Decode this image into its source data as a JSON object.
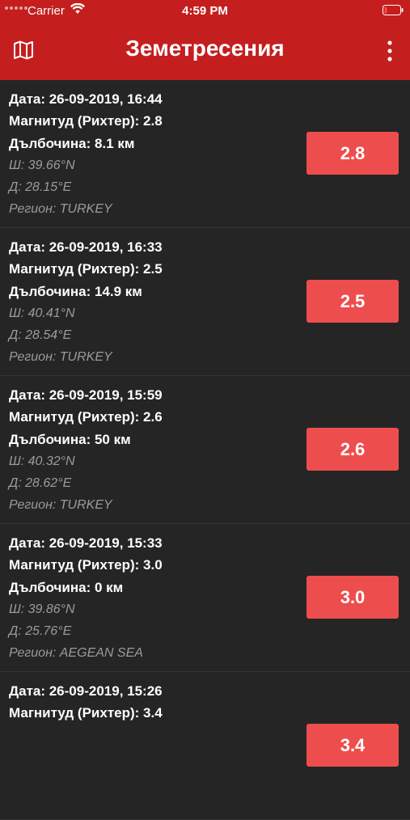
{
  "status_bar": {
    "carrier": "Carrier",
    "time": "4:59 PM"
  },
  "header": {
    "title": "Земетресения",
    "left_icon": "map-icon",
    "right_icon": "more-vertical-icon"
  },
  "colors": {
    "header_bg": "#c41e1e",
    "list_bg": "#252525",
    "magnitude_button": "#ee4d4d",
    "secondary_text": "#9b9b9b"
  },
  "earthquakes": [
    {
      "date": "Дата: 26-09-2019, 16:44",
      "magnitude": "Магнитуд (Рихтер): 2.8",
      "depth": "Дълбочина: 8.1 км",
      "lat": "Ш: 39.66°N",
      "lon": "Д: 28.15°E",
      "region": "Регион: TURKEY",
      "badge": "2.8"
    },
    {
      "date": "Дата: 26-09-2019, 16:33",
      "magnitude": "Магнитуд (Рихтер): 2.5",
      "depth": "Дълбочина: 14.9 км",
      "lat": "Ш: 40.41°N",
      "lon": "Д: 28.54°E",
      "region": "Регион: TURKEY",
      "badge": "2.5"
    },
    {
      "date": "Дата: 26-09-2019, 15:59",
      "magnitude": "Магнитуд (Рихтер): 2.6",
      "depth": "Дълбочина: 50 км",
      "lat": "Ш: 40.32°N",
      "lon": "Д: 28.62°E",
      "region": "Регион: TURKEY",
      "badge": "2.6"
    },
    {
      "date": "Дата: 26-09-2019, 15:33",
      "magnitude": "Магнитуд (Рихтер): 3.0",
      "depth": "Дълбочина: 0 км",
      "lat": "Ш: 39.86°N",
      "lon": "Д: 25.76°E",
      "region": "Регион: AEGEAN SEA",
      "badge": "3.0"
    },
    {
      "date": "Дата: 26-09-2019, 15:26",
      "magnitude": "Магнитуд (Рихтер): 3.4",
      "depth": "",
      "lat": "",
      "lon": "",
      "region": "",
      "badge": "3.4"
    }
  ]
}
